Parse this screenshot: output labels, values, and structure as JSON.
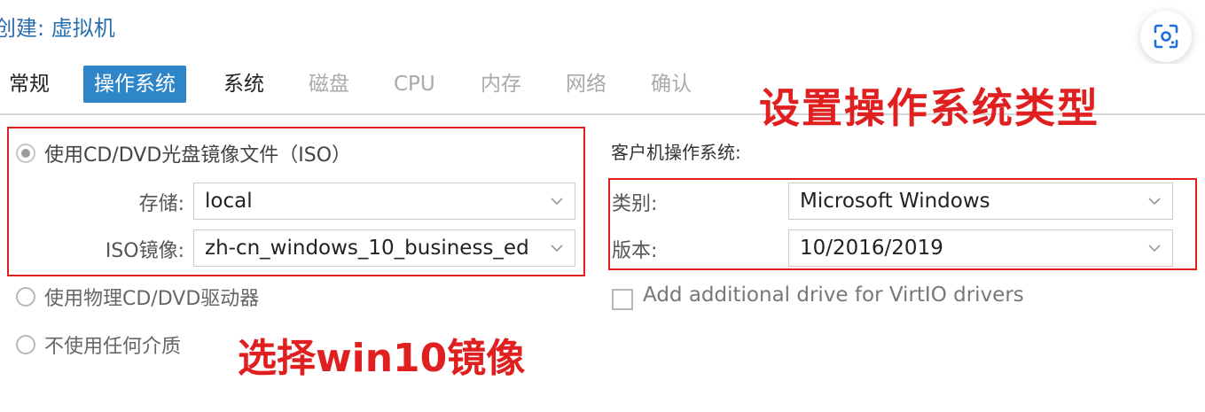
{
  "window": {
    "title": "创建: 虚拟机"
  },
  "tabs": [
    {
      "label": "常规",
      "state": "enabled"
    },
    {
      "label": "操作系统",
      "state": "active"
    },
    {
      "label": "系统",
      "state": "enabled"
    },
    {
      "label": "磁盘",
      "state": "disabled"
    },
    {
      "label": "CPU",
      "state": "disabled"
    },
    {
      "label": "内存",
      "state": "disabled"
    },
    {
      "label": "网络",
      "state": "disabled"
    },
    {
      "label": "确认",
      "state": "disabled"
    }
  ],
  "media": {
    "option_iso": {
      "label": "使用CD/DVD光盘镜像文件（ISO）",
      "checked": true
    },
    "storage": {
      "label": "存储:",
      "value": "local"
    },
    "iso_image": {
      "label": "ISO镜像:",
      "value": "zh-cn_windows_10_business_ed"
    },
    "option_physical": {
      "label": "使用物理CD/DVD驱动器",
      "checked": false
    },
    "option_none": {
      "label": "不使用任何介质",
      "checked": false
    }
  },
  "guest_os": {
    "heading": "客户机操作系统:",
    "type": {
      "label": "类别:",
      "value": "Microsoft Windows"
    },
    "version": {
      "label": "版本:",
      "value": "10/2016/2019"
    },
    "virtio": {
      "label": "Add additional drive for VirtIO drivers",
      "checked": false
    }
  },
  "annotations": {
    "right": "设置操作系统类型",
    "left": "选择win10镜像",
    "color": "#e02020"
  },
  "colors": {
    "accent": "#2e86c9",
    "title": "#2a6fad"
  },
  "icons": {
    "scan": "scan-lens-icon",
    "chevron": "chevron-down-icon"
  }
}
